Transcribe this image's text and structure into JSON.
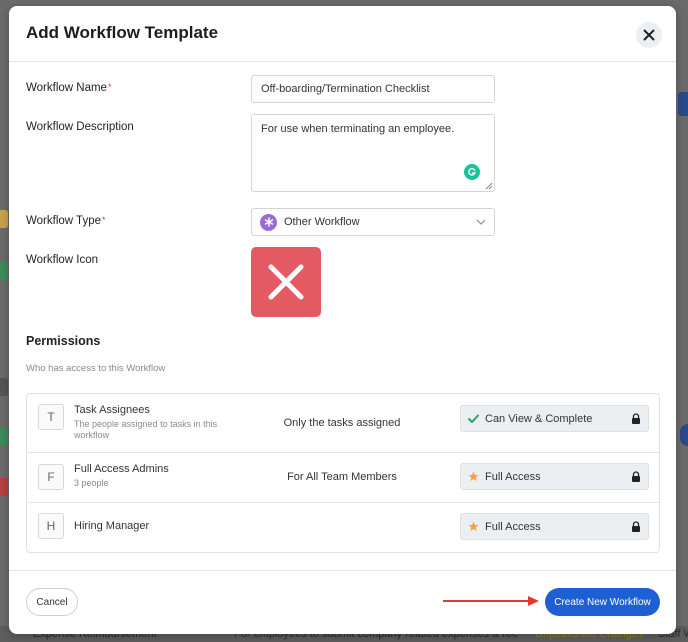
{
  "modal": {
    "title": "Add Workflow Template",
    "close_icon": "close-icon"
  },
  "form": {
    "name_label": "Workflow Name",
    "name_value": "Off-boarding/Termination Checklist",
    "description_label": "Workflow Description",
    "description_value": "For use when terminating an employee.",
    "type_label": "Workflow Type",
    "type_value": "Other Workflow",
    "icon_label": "Workflow Icon",
    "required_mark": "*"
  },
  "permissions": {
    "title": "Permissions",
    "subtitle": "Who has access to this Workflow",
    "rows": [
      {
        "letter": "T",
        "name": "Task Assignees",
        "description": "The people assigned to tasks in this workflow",
        "scope": "Only the tasks assigned",
        "access": "Can View & Complete",
        "access_icon": "check-icon"
      },
      {
        "letter": "F",
        "name": "Full Access Admins",
        "description": "3 people",
        "scope": "For All Team Members",
        "access": "Full Access",
        "access_icon": "star-icon"
      },
      {
        "letter": "H",
        "name": "Hiring Manager",
        "description": "",
        "scope": "",
        "access": "Full Access",
        "access_icon": "star-icon"
      }
    ]
  },
  "footer": {
    "cancel_label": "Cancel",
    "create_label": "Create New Workflow"
  },
  "background": {
    "bottom_left_text": "Expense Reimbursement",
    "bottom_mid_text": "For employees to submit company related expenses & rec",
    "bottom_right_text": "Unpublished Changes",
    "bottom_far_text": "Staff W"
  },
  "colors": {
    "primary": "#1e5fd4",
    "icon_tile": "#e35a62",
    "type_dot": "#9b6bd4",
    "check": "#2aa56b",
    "star": "#f0a53c",
    "arrow": "#e0392b"
  }
}
